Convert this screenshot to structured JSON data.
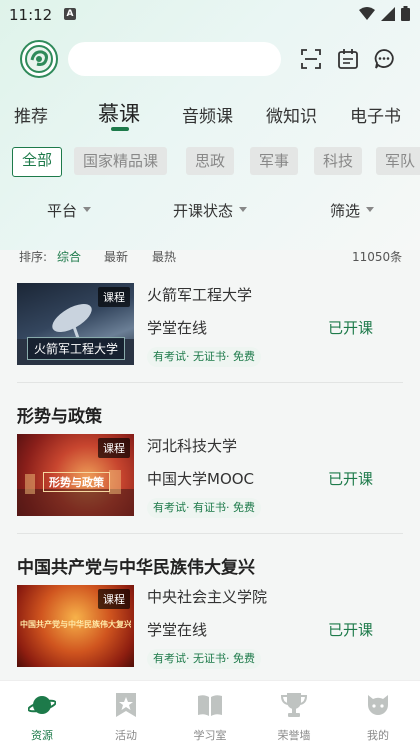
{
  "status_bar": {
    "time": "11:12",
    "notification_icon": "A"
  },
  "header": {
    "search_placeholder": ""
  },
  "tabs": [
    {
      "label": "推荐"
    },
    {
      "label": "慕课"
    },
    {
      "label": "音频课"
    },
    {
      "label": "微知识"
    },
    {
      "label": "电子书"
    }
  ],
  "chips": [
    {
      "label": "全部"
    },
    {
      "label": "国家精品课"
    },
    {
      "label": "思政"
    },
    {
      "label": "军事"
    },
    {
      "label": "科技"
    },
    {
      "label": "军队"
    }
  ],
  "filters": [
    {
      "label": "平台"
    },
    {
      "label": "开课状态"
    },
    {
      "label": "筛选"
    }
  ],
  "sort": {
    "prefix": "排序:",
    "options": [
      {
        "label": "综合"
      },
      {
        "label": "最新"
      },
      {
        "label": "最热"
      }
    ],
    "count": "11050条"
  },
  "courses": [
    {
      "title": "",
      "thumb_badge": "课程",
      "thumb_caption": "火箭军工程大学",
      "institution": "火箭军工程大学",
      "platform": "学堂在线",
      "status": "已开课",
      "tags": "有考试· 无证书· 免费"
    },
    {
      "title": "形势与政策",
      "thumb_badge": "课程",
      "thumb_caption": "形势与政策",
      "institution": "河北科技大学",
      "platform": "中国大学MOOC",
      "status": "已开课",
      "tags": "有考试· 有证书· 免费"
    },
    {
      "title": "中国共产党与中华民族伟大复兴",
      "thumb_badge": "课程",
      "thumb_caption": "中国共产党与中华民族伟大复兴",
      "institution": "中央社会主义学院",
      "platform": "学堂在线",
      "status": "已开课",
      "tags": "有考试· 无证书· 免费"
    }
  ],
  "bottom_nav": [
    {
      "label": "资源",
      "icon": "planet-icon"
    },
    {
      "label": "活动",
      "icon": "star-bookmark-icon"
    },
    {
      "label": "学习室",
      "icon": "book-icon"
    },
    {
      "label": "荣誉墙",
      "icon": "trophy-icon"
    },
    {
      "label": "我的",
      "icon": "face-icon"
    }
  ],
  "colors": {
    "accent": "#1d7a4a"
  }
}
